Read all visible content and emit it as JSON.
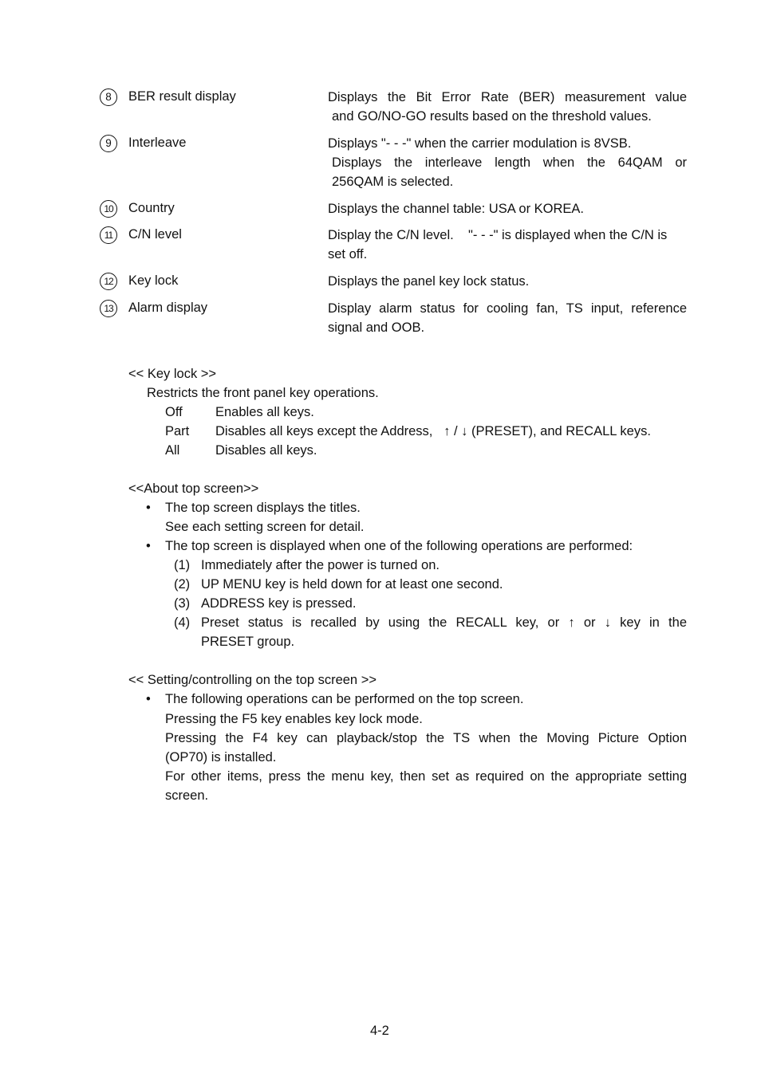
{
  "items": [
    {
      "number": "8",
      "label": "BER result display",
      "lines": [
        "Displays the Bit Error Rate (BER) measurement value",
        "and GO/NO-GO results based on the threshold values."
      ]
    },
    {
      "number": "9",
      "label": "Interleave",
      "lines": [
        "Displays \"- - -\" when the carrier modulation is 8VSB.",
        "Displays the interleave length when the 64QAM or",
        "256QAM is selected."
      ]
    },
    {
      "number": "10",
      "label": "Country",
      "lines": [
        "Displays the channel table: USA or KOREA."
      ]
    },
    {
      "number": "11",
      "label": "C/N level",
      "lines": [
        "Display the C/N level.    \"- - -\" is displayed when the C/N is",
        "set off."
      ]
    },
    {
      "number": "12",
      "label": "Key lock",
      "lines": [
        "Displays the panel key lock status."
      ]
    },
    {
      "number": "13",
      "label": "Alarm display",
      "lines": [
        "Display alarm status for cooling fan, TS input, reference",
        "signal and OOB."
      ]
    }
  ],
  "key_lock": {
    "heading": "<< Key lock >>",
    "intro": "Restricts the front panel key operations.",
    "modes": [
      {
        "name": "Off",
        "desc": "Enables all keys."
      },
      {
        "name": "Part",
        "desc": "Disables all keys except the Address,   ↑ / ↓ (PRESET), and RECALL keys."
      },
      {
        "name": "All",
        "desc": "Disables all keys."
      }
    ]
  },
  "about_top": {
    "heading": "<<About top screen>>",
    "bullet_char": "•",
    "bullet1": [
      "The top screen displays the titles.",
      "See each setting screen for detail."
    ],
    "bullet2": "The top screen is displayed when one of the following operations are performed:",
    "steps": [
      {
        "n": "(1)",
        "text": "Immediately after the power is turned on."
      },
      {
        "n": "(2)",
        "text": "UP MENU key is held down for at least one second."
      },
      {
        "n": "(3)",
        "text": "ADDRESS key is pressed."
      },
      {
        "n": "(4)",
        "text": "Preset status is recalled by using the RECALL key, or  ↑  or  ↓  key in the",
        "text2": "PRESET group."
      }
    ]
  },
  "setting_top": {
    "heading": "<< Setting/controlling on the top screen >>",
    "bullet_char": "•",
    "lines": [
      "The following operations can be performed on the top screen.",
      "Pressing the F5 key enables key lock mode.",
      "Pressing the F4 key can playback/stop the TS when the Moving Picture Option",
      "(OP70) is installed.",
      "For other items, press the menu key, then set as required on the appropriate setting",
      "screen."
    ]
  },
  "page_number": "4-2"
}
